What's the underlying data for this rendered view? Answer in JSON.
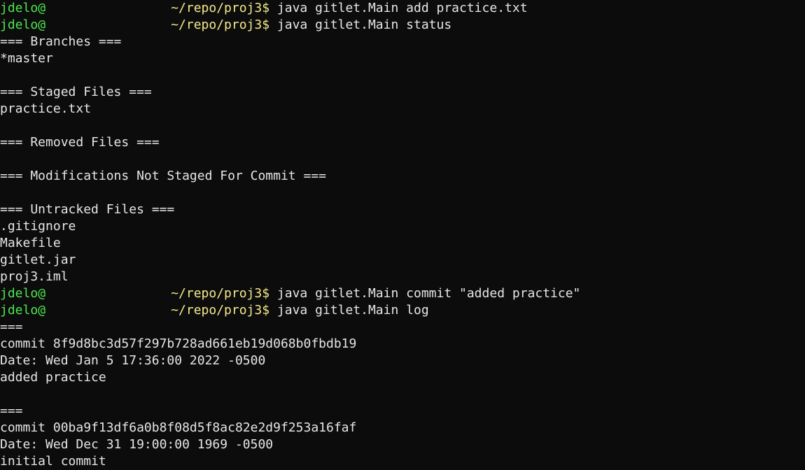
{
  "prompt": {
    "user": "jdelo",
    "at": "@",
    "path": "~/repo/proj3",
    "symbol": "$"
  },
  "lines": [
    {
      "type": "prompt",
      "command": "java gitlet.Main add practice.txt"
    },
    {
      "type": "prompt",
      "command": "java gitlet.Main status"
    },
    {
      "type": "output",
      "text": "=== Branches ==="
    },
    {
      "type": "output",
      "text": "*master"
    },
    {
      "type": "output",
      "text": ""
    },
    {
      "type": "output",
      "text": "=== Staged Files ==="
    },
    {
      "type": "output",
      "text": "practice.txt"
    },
    {
      "type": "output",
      "text": ""
    },
    {
      "type": "output",
      "text": "=== Removed Files ==="
    },
    {
      "type": "output",
      "text": ""
    },
    {
      "type": "output",
      "text": "=== Modifications Not Staged For Commit ==="
    },
    {
      "type": "output",
      "text": ""
    },
    {
      "type": "output",
      "text": "=== Untracked Files ==="
    },
    {
      "type": "output",
      "text": ".gitignore"
    },
    {
      "type": "output",
      "text": "Makefile"
    },
    {
      "type": "output",
      "text": "gitlet.jar"
    },
    {
      "type": "output",
      "text": "proj3.iml"
    },
    {
      "type": "prompt",
      "command": "java gitlet.Main commit \"added practice\""
    },
    {
      "type": "prompt",
      "command": "java gitlet.Main log"
    },
    {
      "type": "output",
      "text": "==="
    },
    {
      "type": "output",
      "text": "commit 8f9d8bc3d57f297b728ad661eb19d068b0fbdb19"
    },
    {
      "type": "output",
      "text": "Date: Wed Jan 5 17:36:00 2022 -0500"
    },
    {
      "type": "output",
      "text": "added practice"
    },
    {
      "type": "output",
      "text": ""
    },
    {
      "type": "output",
      "text": "==="
    },
    {
      "type": "output",
      "text": "commit 00ba9f13df6a0b8f08d5f8ac82e2d9f253a16faf"
    },
    {
      "type": "output",
      "text": "Date: Wed Dec 31 19:00:00 1969 -0500"
    },
    {
      "type": "output",
      "text": "initial commit"
    }
  ]
}
